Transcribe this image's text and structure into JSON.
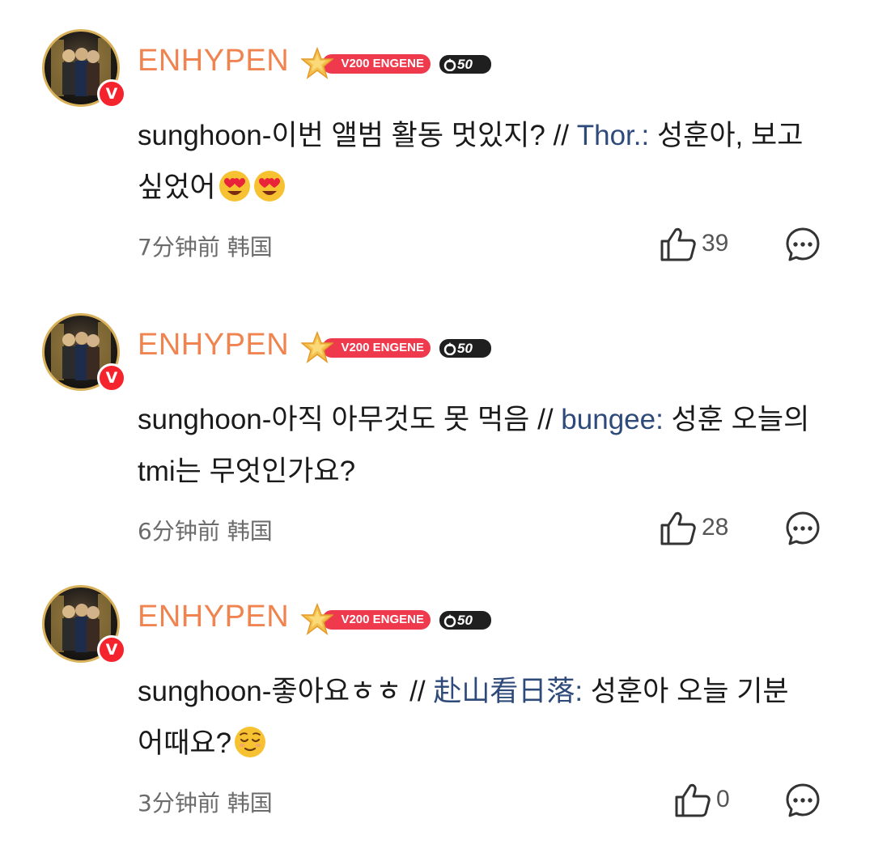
{
  "comments": [
    {
      "username": "ENHYPEN",
      "avatar_badge": "V",
      "rank_badge": "V200 ENGENE",
      "level_badge": "50",
      "text": "sunghoon-이번 앨범 활동 멋있지? // ",
      "reply_to": "Thor.:",
      "reply_text": " 성훈아, 보고 싶었어",
      "emojis": [
        "heart-eyes-emoji",
        "heart-eyes-emoji"
      ],
      "time": "7分钟前 韩国",
      "likes": "39",
      "icons": {
        "like": "thumbs-up-icon",
        "reply": "comment-bubble-icon"
      }
    },
    {
      "username": "ENHYPEN",
      "avatar_badge": "V",
      "rank_badge": "V200 ENGENE",
      "level_badge": "50",
      "text": "sunghoon-아직 아무것도 못 먹음 // ",
      "reply_to": "bungee:",
      "reply_text": " 성훈 오늘의 tmi는 무엇인가요?",
      "emojis": [],
      "time": "6分钟前 韩国",
      "likes": "28",
      "icons": {
        "like": "thumbs-up-icon",
        "reply": "comment-bubble-icon"
      }
    },
    {
      "username": "ENHYPEN",
      "avatar_badge": "V",
      "rank_badge": "V200 ENGENE",
      "level_badge": "50",
      "text": "sunghoon-좋아요ㅎㅎ // ",
      "reply_to": "赴山看日落:",
      "reply_text": " 성훈아 오늘 기분 어때요?",
      "emojis": [
        "relieved-face-emoji"
      ],
      "time": "3分钟前 韩国",
      "likes": "0",
      "icons": {
        "like": "thumbs-up-icon",
        "reply": "comment-bubble-icon"
      }
    }
  ],
  "colors": {
    "username": "#f08450",
    "rank_badge": "#ee3a4c",
    "reply_name": "#2e4a7a",
    "meta_text": "#6b6b6b",
    "v_badge": "#f5232d"
  }
}
